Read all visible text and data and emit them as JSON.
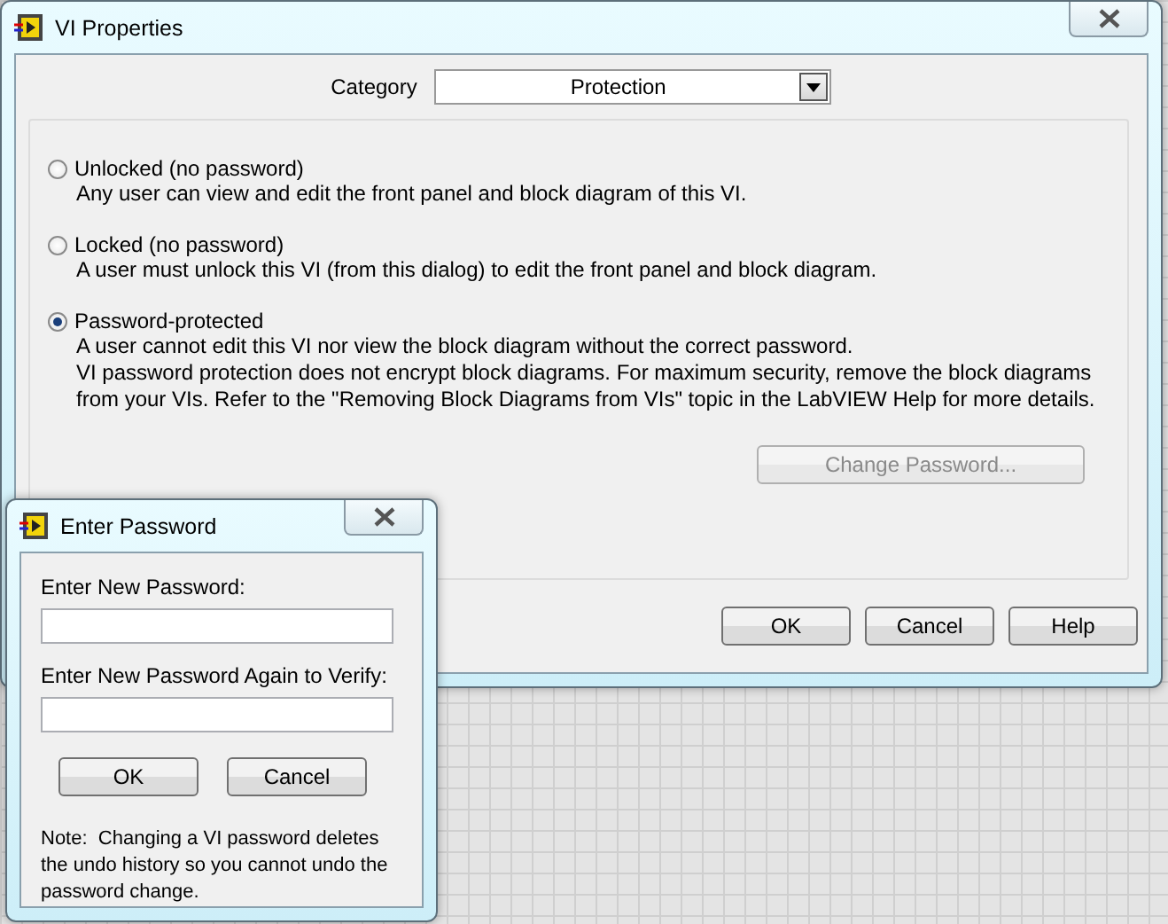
{
  "main_window": {
    "title": "VI Properties",
    "category": {
      "label": "Category",
      "value": "Protection"
    },
    "options": [
      {
        "label": "Unlocked (no password)",
        "selected": false,
        "description": [
          "Any user can view and edit the front panel and block diagram of this VI."
        ]
      },
      {
        "label": "Locked (no password)",
        "selected": false,
        "description": [
          "A user must unlock this VI (from this dialog) to edit the front panel and block diagram."
        ]
      },
      {
        "label": "Password-protected",
        "selected": true,
        "description": [
          "A user cannot edit this VI nor view the block diagram without the correct password.",
          "VI password protection does not encrypt block diagrams. For maximum security, remove the block diagrams from your VIs. Refer to the \"Removing Block Diagrams from VIs\" topic in the LabVIEW Help for more details."
        ]
      }
    ],
    "change_password_button": {
      "label": "Change Password...",
      "disabled": true
    },
    "buttons": [
      "OK",
      "Cancel",
      "Help"
    ]
  },
  "password_dialog": {
    "title": "Enter Password",
    "fields": [
      {
        "label": "Enter New Password:"
      },
      {
        "label": "Enter New Password Again to Verify:"
      }
    ],
    "buttons": [
      "OK",
      "Cancel"
    ],
    "note": "Note:  Changing a VI password deletes the undo history so you cannot undo the password change."
  }
}
